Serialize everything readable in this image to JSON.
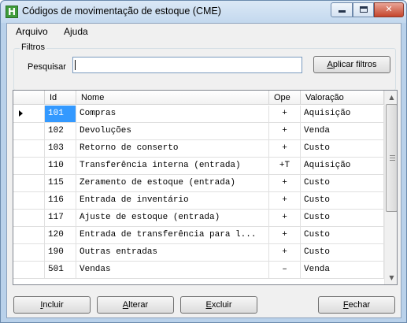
{
  "window": {
    "title": "Códigos de movimentação de estoque (CME)",
    "app_icon_letter": "H",
    "controls": {
      "minimize": "minimize-icon",
      "maximize": "maximize-icon",
      "close": "✕"
    }
  },
  "menu": [
    {
      "label": "Arquivo"
    },
    {
      "label": "Ajuda"
    }
  ],
  "filters": {
    "legend": "Filtros",
    "search_label": "Pesquisar",
    "search_value": "",
    "search_placeholder": "",
    "apply_label_accel": "A",
    "apply_label_rest": "plicar filtros"
  },
  "grid": {
    "columns": [
      "Id",
      "Nome",
      "Ope",
      "Valoração"
    ],
    "selected_row_index": 0,
    "rows": [
      {
        "id": "101",
        "nome": "Compras",
        "ope": "+",
        "valoracao": "Aquisição"
      },
      {
        "id": "102",
        "nome": "Devoluções",
        "ope": "+",
        "valoracao": "Venda"
      },
      {
        "id": "103",
        "nome": "Retorno de conserto",
        "ope": "+",
        "valoracao": "Custo"
      },
      {
        "id": "110",
        "nome": "Transferência interna (entrada)",
        "ope": "+T",
        "valoracao": "Aquisição"
      },
      {
        "id": "115",
        "nome": "Zeramento de estoque (entrada)",
        "ope": "+",
        "valoracao": "Custo"
      },
      {
        "id": "116",
        "nome": "Entrada de inventário",
        "ope": "+",
        "valoracao": "Custo"
      },
      {
        "id": "117",
        "nome": "Ajuste de estoque (entrada)",
        "ope": "+",
        "valoracao": "Custo"
      },
      {
        "id": "120",
        "nome": "Entrada de transferência para l...",
        "ope": "+",
        "valoracao": "Custo"
      },
      {
        "id": "190",
        "nome": "Outras entradas",
        "ope": "+",
        "valoracao": "Custo"
      },
      {
        "id": "501",
        "nome": "Vendas",
        "ope": "–",
        "valoracao": "Venda"
      }
    ]
  },
  "buttons": {
    "incluir": {
      "accel": "I",
      "rest": "ncluir"
    },
    "alterar": {
      "accel": "A",
      "rest": "lterar"
    },
    "excluir": {
      "accel": "E",
      "rest": "xcluir"
    },
    "fechar": {
      "accel": "F",
      "rest": "echar"
    }
  },
  "colors": {
    "selection": "#3399ff",
    "title_bar": "#c3d8ee",
    "close_button": "#c5442b"
  }
}
